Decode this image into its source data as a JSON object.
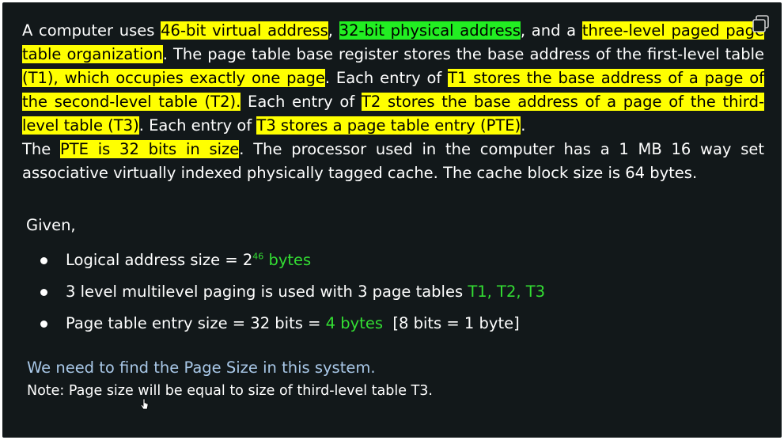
{
  "problem": {
    "p1": "A computer uses ",
    "h1": "46-bit virtual address",
    "p2": ", ",
    "h2": "32-bit physical address",
    "p3": ", and a ",
    "h3": "three-level paged page table organization",
    "p4": ". The page table base register stores the base address of the first-level table ",
    "h4": "(T1), which occupies exactly one page",
    "p5": ". Each entry of ",
    "h5": "T1 stores the base address of a page of the second-level table (T2).",
    "p6": " Each entry of ",
    "h6": "T2 stores the base address of a page of the third-level table (T3)",
    "p7": ". Each entry of ",
    "h7": "T3 stores a page table entry (PTE)",
    "p8": ".",
    "q1": "The ",
    "h8": "PTE is 32 bits in size",
    "q2": ". The processor used in the computer has a 1 MB 16 way set associative virtually indexed physically tagged cache. The cache block size is 64 bytes."
  },
  "given": {
    "heading": "Given,",
    "items": [
      {
        "label": "Logical address size = 2",
        "sup": "46",
        "value": " bytes",
        "extra": ""
      },
      {
        "label": "3 level multilevel paging is used with 3 page tables ",
        "sup": "",
        "value": "T1, T2, T3",
        "extra": ""
      },
      {
        "label": "Page table entry size = 32 bits = ",
        "sup": "",
        "value": "4 bytes",
        "extra": "  [8 bits = 1 byte]"
      }
    ]
  },
  "goal": "We need to find the Page Size in this system.",
  "note": "Note: Page size will be equal to size of third-level table T3.",
  "colors": {
    "background": "#12181a",
    "highlight_yellow": "#ffff00",
    "highlight_green": "#22ee22",
    "value_green": "#33dd33",
    "goal_text": "#a9c8e8"
  },
  "icons": [
    "copy-icon",
    "cursor-icon"
  ]
}
